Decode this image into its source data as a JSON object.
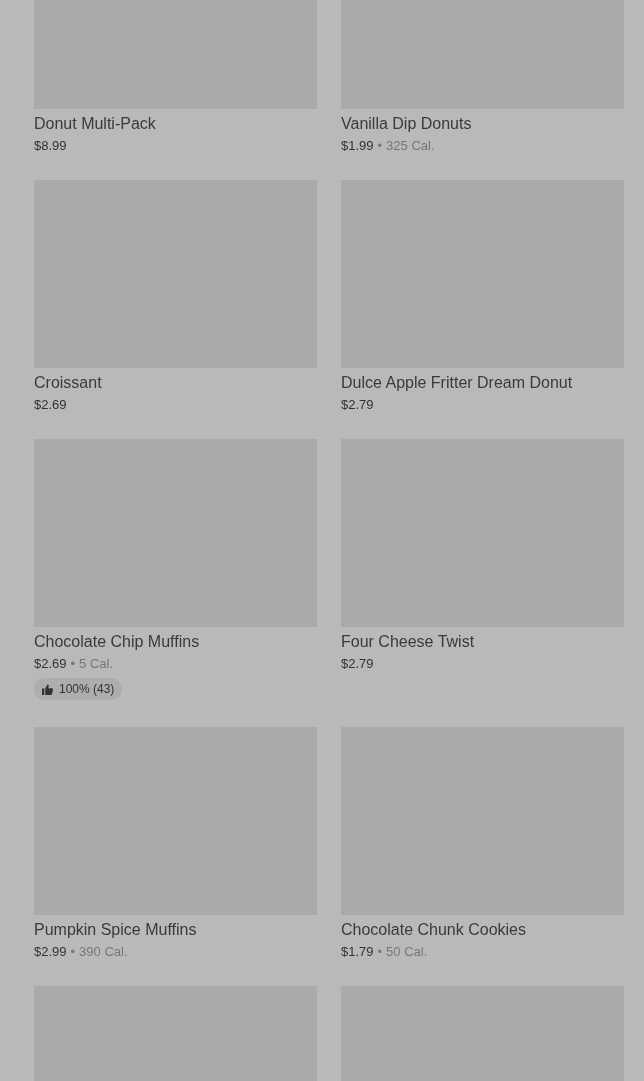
{
  "items": [
    {
      "kind": "product",
      "name": "Donut Multi-Pack",
      "price": "$8.99"
    },
    {
      "kind": "product",
      "name": "Vanilla Dip Donuts",
      "price": "$1.99",
      "separator": "•",
      "calories": "325 Cal."
    },
    {
      "kind": "product",
      "name": "Croissant",
      "price": "$2.69"
    },
    {
      "kind": "product",
      "name": "Dulce Apple Fritter Dream Donut",
      "price": "$2.79"
    },
    {
      "kind": "product",
      "name": "Chocolate Chip Muffins",
      "price": "$2.69",
      "separator": "•",
      "calories": "5 Cal.",
      "rating": "100% (43)"
    },
    {
      "kind": "product",
      "name": "Four Cheese Twist",
      "price": "$2.79"
    },
    {
      "kind": "product",
      "name": "Pumpkin Spice Muffins",
      "price": "$2.99",
      "separator": "•",
      "calories": "390 Cal."
    },
    {
      "kind": "product",
      "name": "Chocolate Chunk Cookies",
      "price": "$1.79",
      "separator": "•",
      "calories": "50 Cal."
    },
    {
      "kind": "image_only"
    },
    {
      "kind": "image_only"
    }
  ]
}
